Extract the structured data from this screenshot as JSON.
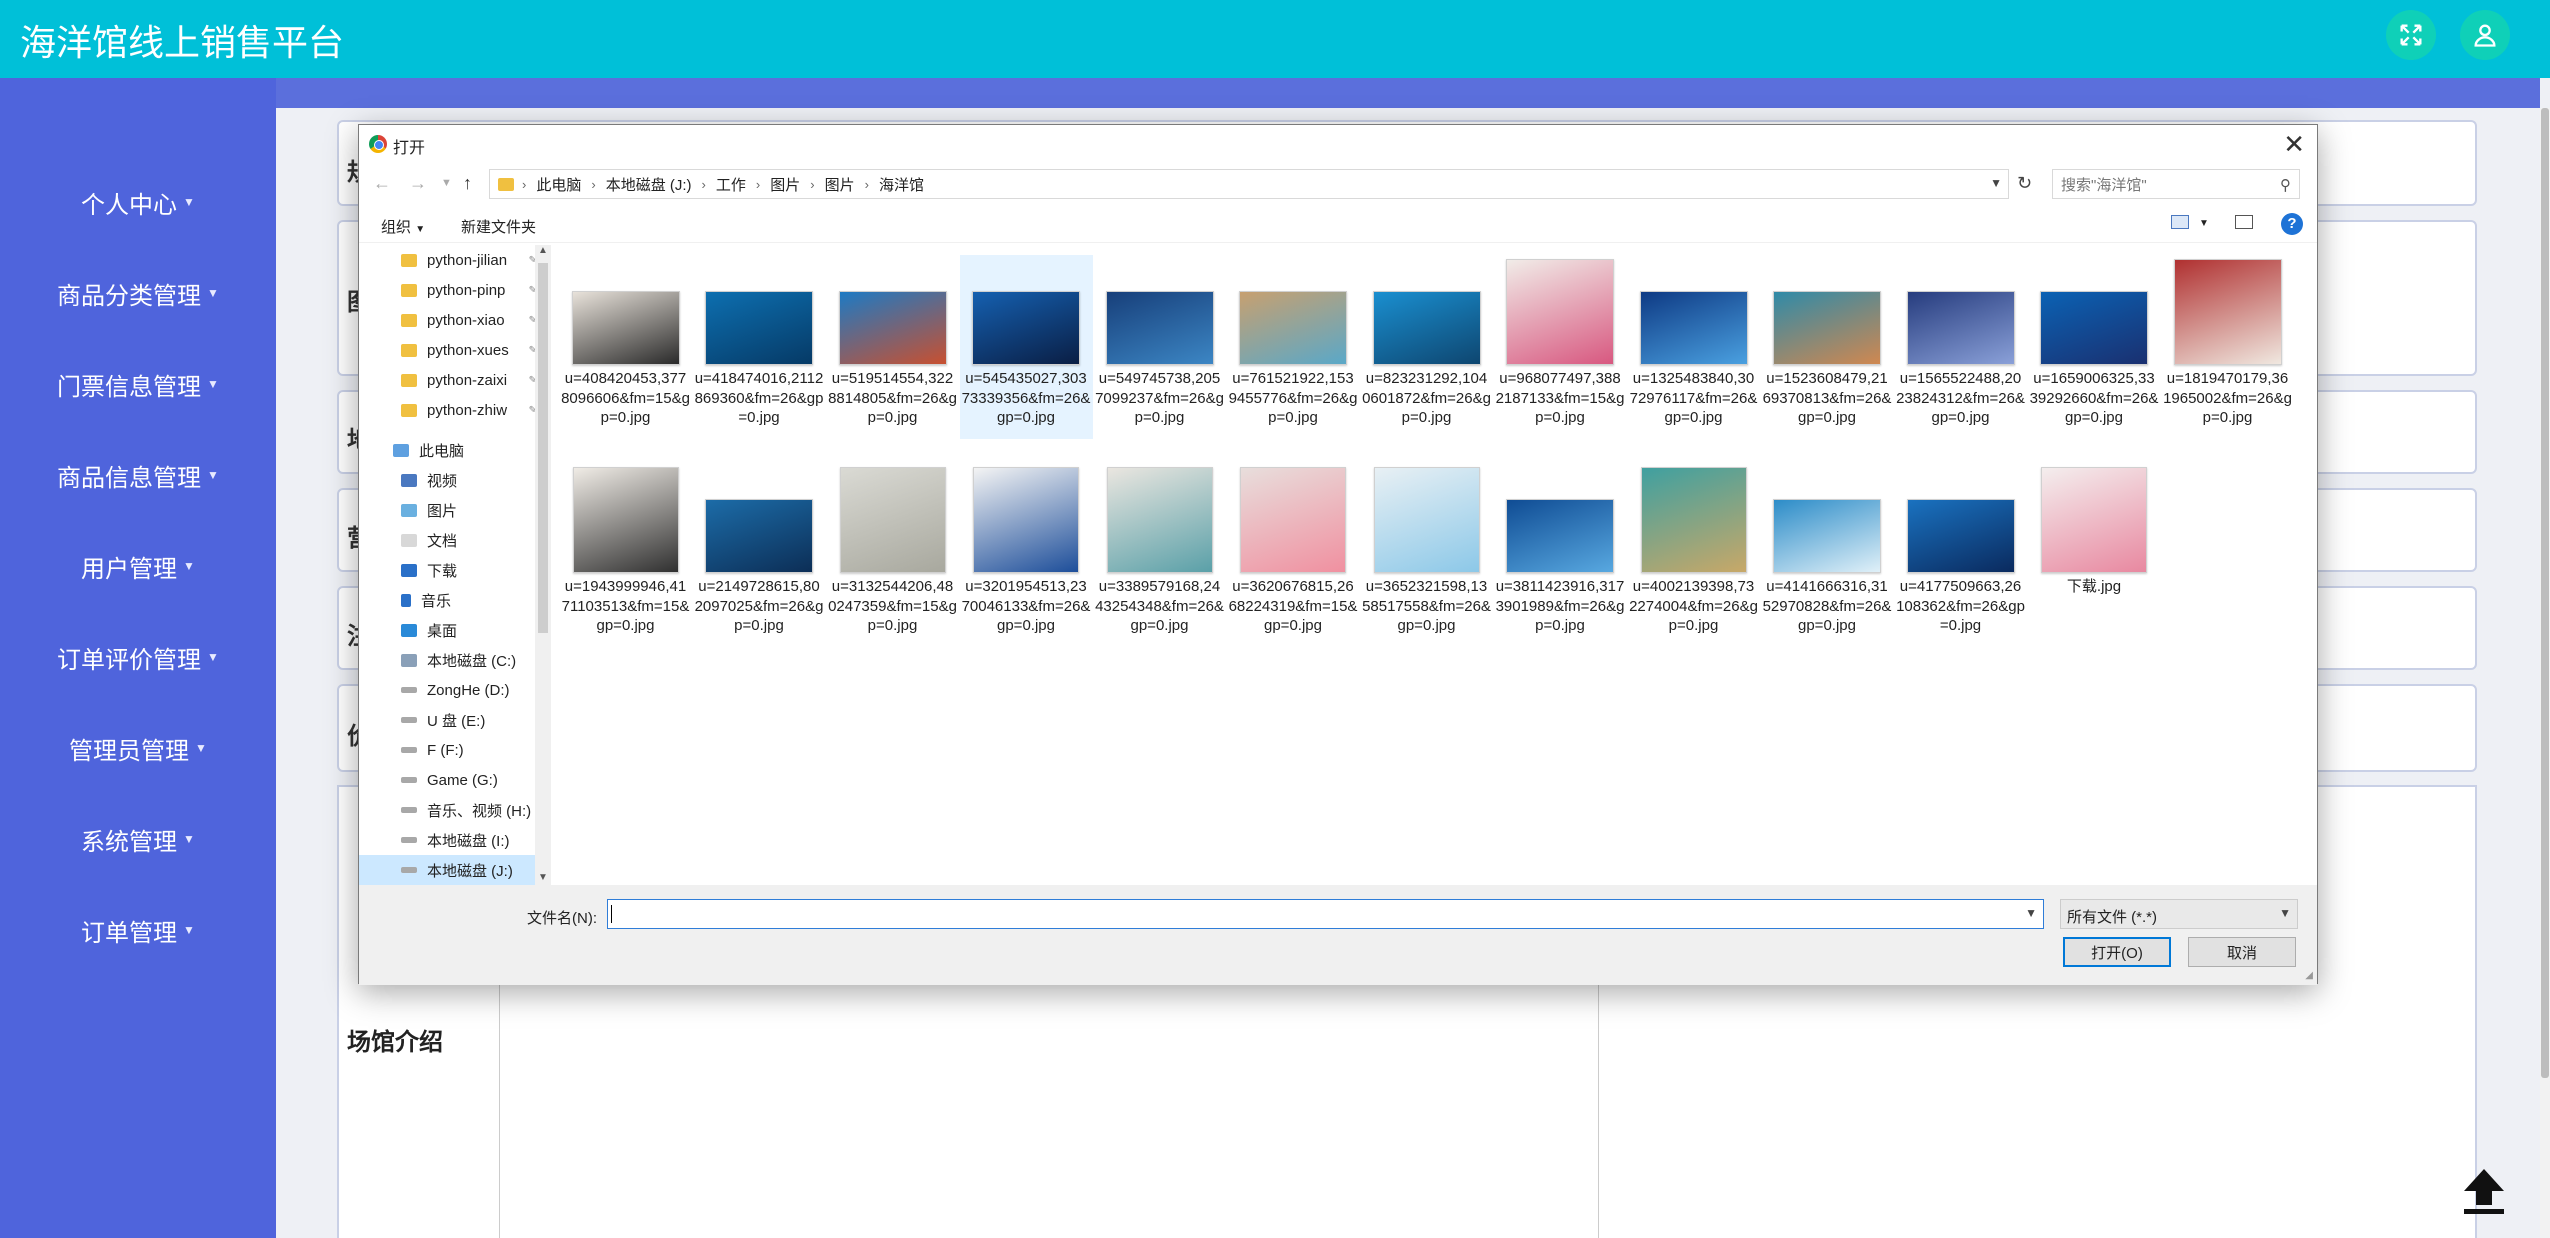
{
  "app": {
    "title": "海洋馆线上销售平台",
    "header_color": "#00c0d8",
    "sidebar_color": "#4f64dc"
  },
  "sidebar": {
    "items": [
      {
        "label": "个人中心"
      },
      {
        "label": "商品分类管理"
      },
      {
        "label": "门票信息管理"
      },
      {
        "label": "商品信息管理"
      },
      {
        "label": "用户管理"
      },
      {
        "label": "订单评价管理"
      },
      {
        "label": "管理员管理"
      },
      {
        "label": "系统管理"
      },
      {
        "label": "订单管理"
      }
    ]
  },
  "form": {
    "partial_labels": [
      "规",
      "图",
      "地",
      "营",
      "注",
      "价"
    ],
    "intro_label": "场馆介绍"
  },
  "dialog": {
    "title": "打开",
    "breadcrumb": [
      "此电脑",
      "本地磁盘 (J:)",
      "工作",
      "图片",
      "图片",
      "海洋馆"
    ],
    "search_placeholder": "搜索\"海洋馆\"",
    "toolbar": {
      "organize": "组织",
      "new_folder": "新建文件夹"
    },
    "nav_pane": [
      {
        "label": "python-jilian",
        "pinned": true
      },
      {
        "label": "python-pinp",
        "pinned": true
      },
      {
        "label": "python-xiao",
        "pinned": true
      },
      {
        "label": "python-xues",
        "pinned": true
      },
      {
        "label": "python-zaixi",
        "pinned": true
      },
      {
        "label": "python-zhiw",
        "pinned": true
      },
      {
        "label": "此电脑"
      },
      {
        "label": "视频"
      },
      {
        "label": "图片"
      },
      {
        "label": "文档"
      },
      {
        "label": "下载"
      },
      {
        "label": "音乐"
      },
      {
        "label": "桌面"
      },
      {
        "label": "本地磁盘 (C:)"
      },
      {
        "label": "ZongHe (D:)"
      },
      {
        "label": "U 盘 (E:)"
      },
      {
        "label": "F (F:)"
      },
      {
        "label": "Game (G:)"
      },
      {
        "label": "音乐、视频 (H:)"
      },
      {
        "label": "本地磁盘 (I:)"
      },
      {
        "label": "本地磁盘 (J:)",
        "selected": true
      }
    ],
    "files": [
      {
        "name": "u=408420453,3778096606&fm=15&gp=0.jpg",
        "colors": [
          "#e8e2da",
          "#2a2a2a"
        ]
      },
      {
        "name": "u=418474016,2112869360&fm=26&gp=0.jpg",
        "colors": [
          "#0d6fb0",
          "#063a66"
        ]
      },
      {
        "name": "u=519514554,3228814805&fm=26&gp=0.jpg",
        "colors": [
          "#1d7ac4",
          "#c85030"
        ]
      },
      {
        "name": "u=545435027,30373339356&fm=26&gp=0.jpg",
        "colors": [
          "#1560b0",
          "#0a1e44"
        ],
        "selected": true
      },
      {
        "name": "u=549745738,2057099237&fm=26&gp=0.jpg",
        "colors": [
          "#173f7a",
          "#3c86c4"
        ]
      },
      {
        "name": "u=761521922,1539455776&fm=26&gp=0.jpg",
        "colors": [
          "#c7a070",
          "#5aa8c8"
        ]
      },
      {
        "name": "u=823231292,1040601872&fm=26&gp=0.jpg",
        "colors": [
          "#1a8fd0",
          "#0e4670"
        ]
      },
      {
        "name": "u=968077497,3882187133&fm=15&gp=0.jpg",
        "colors": [
          "#f1ece8",
          "#d85880"
        ]
      },
      {
        "name": "u=1325483840,3072976117&fm=26&gp=0.jpg",
        "colors": [
          "#0e3a84",
          "#4aa0e0"
        ]
      },
      {
        "name": "u=1523608479,2169370813&fm=26&gp=0.jpg",
        "colors": [
          "#2f8aa8",
          "#d08850"
        ]
      },
      {
        "name": "u=1565522488,2023824312&fm=26&gp=0.jpg",
        "colors": [
          "#263c7e",
          "#8aa0d8"
        ]
      },
      {
        "name": "u=1659006325,3339292660&fm=26&gp=0.jpg",
        "colors": [
          "#0b62b4",
          "#1a3070"
        ]
      },
      {
        "name": "u=1819470179,361965002&fm=26&gp=0.jpg",
        "colors": [
          "#b03030",
          "#f0e8e0"
        ]
      },
      {
        "name": "u=1943999946,4171103513&fm=15&gp=0.jpg",
        "colors": [
          "#f0ece6",
          "#303030"
        ]
      },
      {
        "name": "u=2149728615,802097025&fm=26&gp=0.jpg",
        "colors": [
          "#1c6ca8",
          "#0c2e56"
        ]
      },
      {
        "name": "u=3132544206,480247359&fm=15&gp=0.jpg",
        "colors": [
          "#dadad4",
          "#a8a89e"
        ]
      },
      {
        "name": "u=3201954513,2370046133&fm=26&gp=0.jpg",
        "colors": [
          "#f4f4f4",
          "#1d4e9a"
        ]
      },
      {
        "name": "u=3389579168,2443254348&fm=26&gp=0.jpg",
        "colors": [
          "#eae6e0",
          "#5aa0a8"
        ]
      },
      {
        "name": "u=3620676815,2668224319&fm=15&gp=0.jpg",
        "colors": [
          "#e8dedc",
          "#f090a0"
        ]
      },
      {
        "name": "u=3652321598,1358517558&fm=26&gp=0.jpg",
        "colors": [
          "#e8f0f4",
          "#8cc8e8"
        ]
      },
      {
        "name": "u=3811423916,3173901989&fm=26&gp=0.jpg",
        "colors": [
          "#0f4c94",
          "#58a8e0"
        ]
      },
      {
        "name": "u=4002139398,732274004&fm=26&gp=0.jpg",
        "colors": [
          "#3fa0a0",
          "#c8a868"
        ]
      },
      {
        "name": "u=4141666316,3152970828&fm=26&gp=0.jpg",
        "colors": [
          "#2c8cc8",
          "#e0f0f8"
        ]
      },
      {
        "name": "u=4177509663,26108362&fm=26&gp=0.jpg",
        "colors": [
          "#1a72c0",
          "#0a2a5e"
        ]
      },
      {
        "name": "下载.jpg",
        "colors": [
          "#f4eeee",
          "#e888a0"
        ]
      }
    ],
    "filename_label": "文件名(N):",
    "filename_value": "",
    "filetype": "所有文件 (*.*)",
    "open_button": "打开(O)",
    "cancel_button": "取消"
  }
}
